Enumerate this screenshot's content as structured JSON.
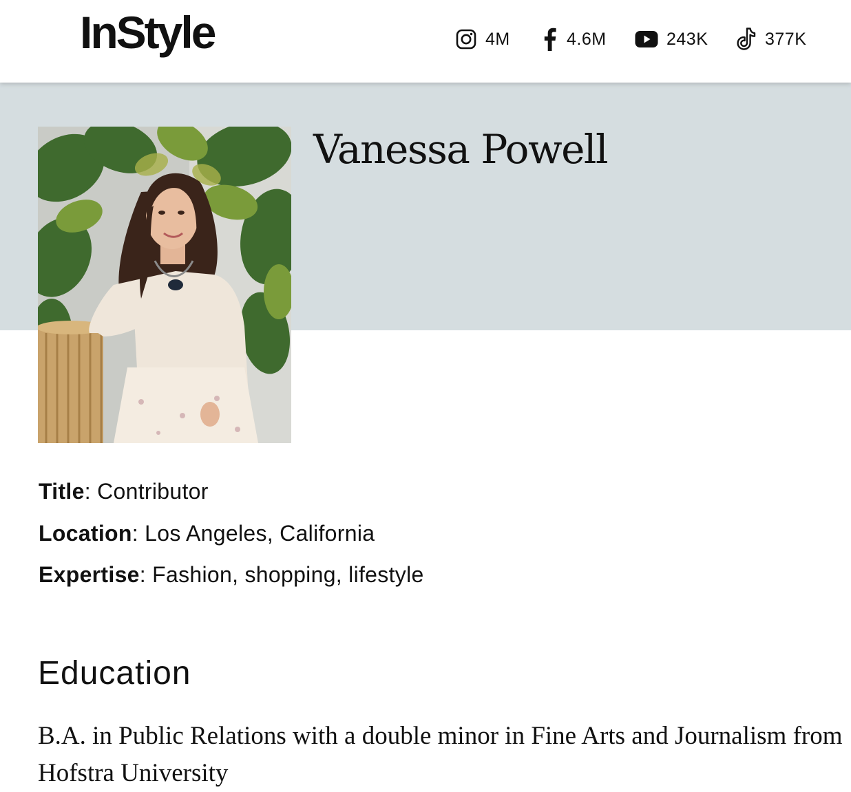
{
  "header": {
    "logo": "InStyle",
    "social": [
      {
        "icon": "instagram-icon",
        "count": "4M"
      },
      {
        "icon": "facebook-icon",
        "count": "4.6M"
      },
      {
        "icon": "youtube-icon",
        "count": "243K"
      },
      {
        "icon": "tiktok-icon",
        "count": "377K"
      }
    ]
  },
  "author": {
    "name": "Vanessa Powell",
    "title_label": "Title",
    "title": "Contributor",
    "location_label": "Location",
    "location": "Los Angeles, California",
    "expertise_label": "Expertise",
    "expertise": "Fashion, shopping, lifestyle"
  },
  "education": {
    "heading": "Education",
    "text": "B.A. in Public Relations with a double minor in Fine Arts and Journalism from Hofstra University"
  },
  "colors": {
    "band": "#d5dde0",
    "text": "#111111"
  }
}
